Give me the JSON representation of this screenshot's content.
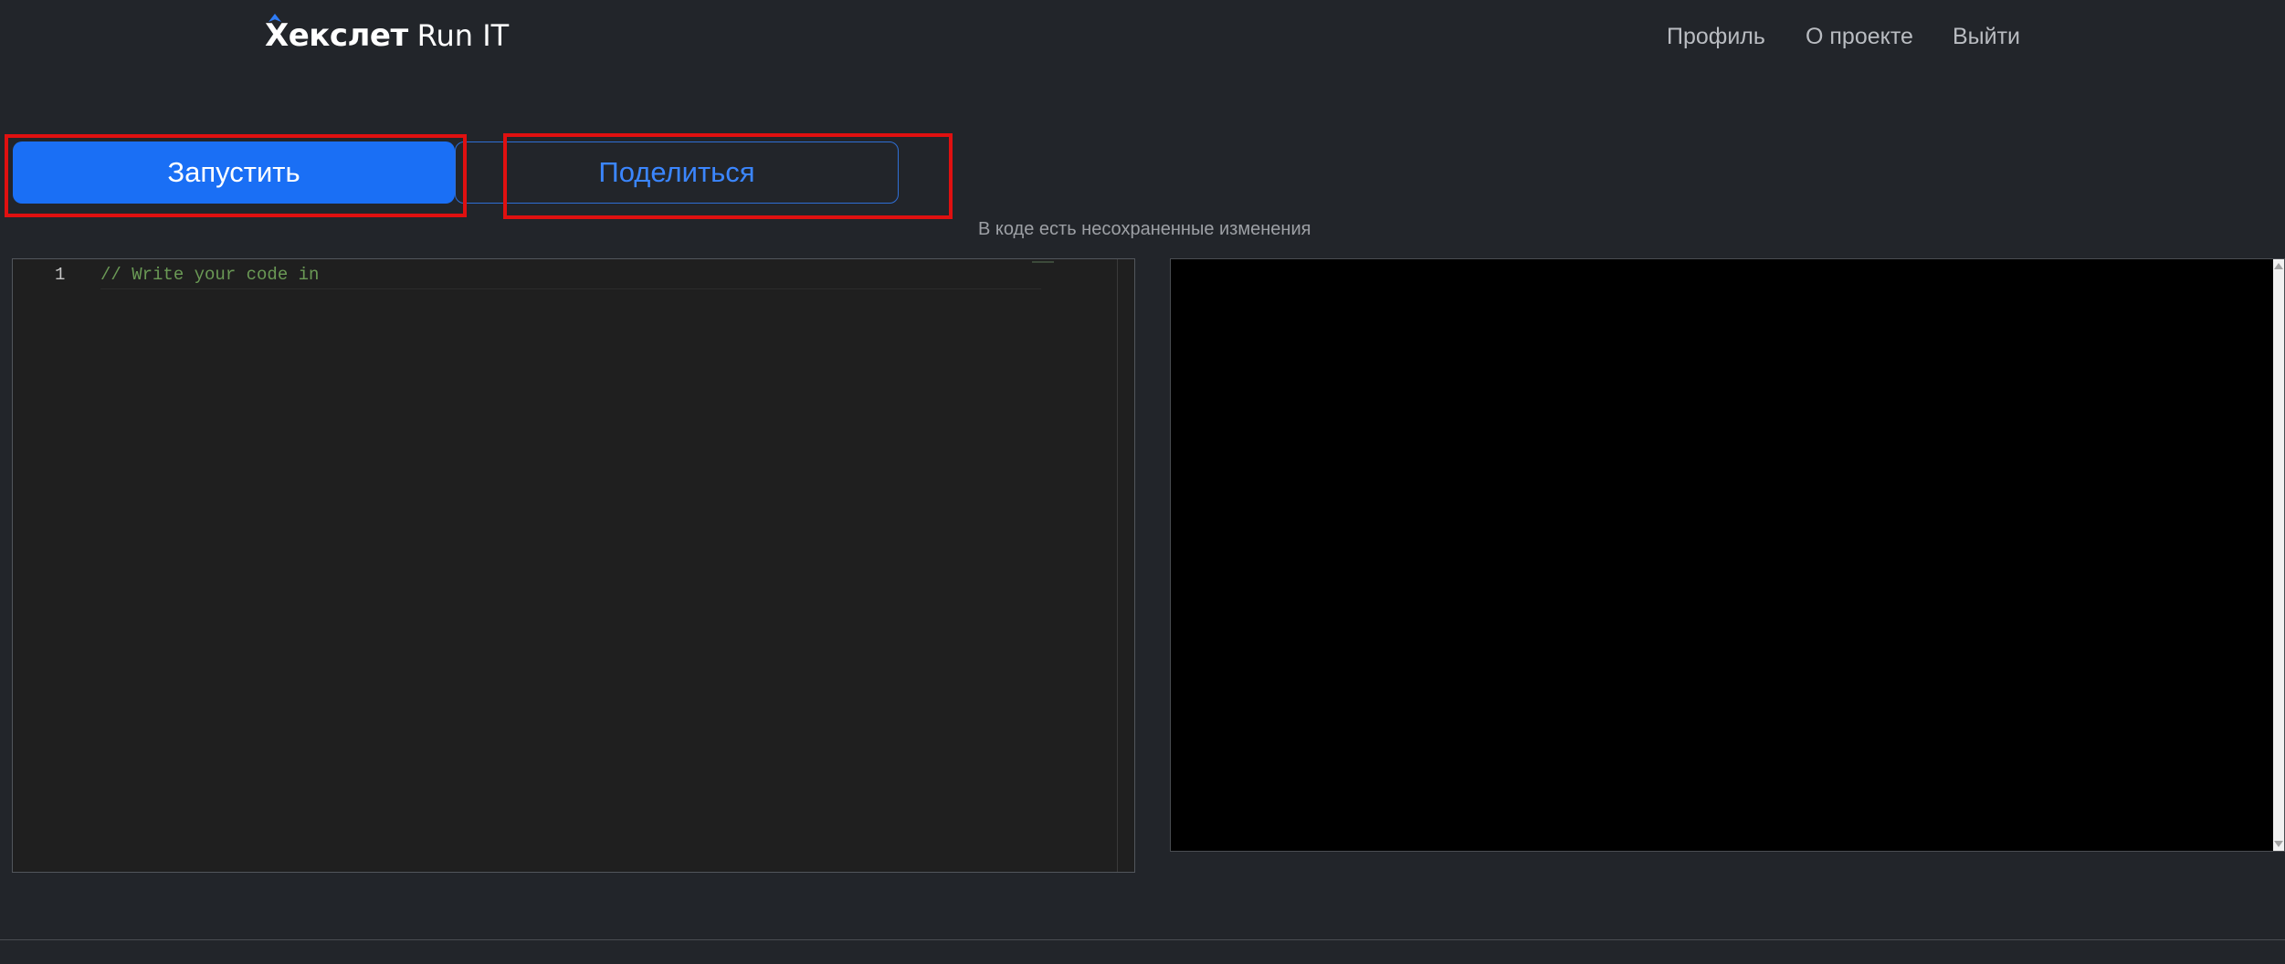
{
  "header": {
    "logo_mark": "Хекслет",
    "logo_name": "Run IT",
    "nav": [
      {
        "label": "Профиль"
      },
      {
        "label": "О проекте"
      },
      {
        "label": "Выйти"
      }
    ]
  },
  "toolbar": {
    "run_label": "Запустить",
    "share_label": "Поделиться",
    "unsaved_notice": "В коде есть несохраненные изменения"
  },
  "editor": {
    "lines": [
      {
        "number": "1",
        "text": "// Write your code in"
      }
    ]
  },
  "colors": {
    "background": "#22252a",
    "accent": "#1a6ff5",
    "highlight": "#e01010",
    "comment": "#6a9955"
  }
}
